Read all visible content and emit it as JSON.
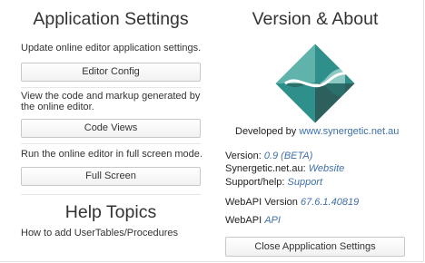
{
  "settings": {
    "title": "Application Settings",
    "items": [
      {
        "description": "Update online editor application settings.",
        "button": "Editor Config"
      },
      {
        "description": "View the code and markup generated by the online editor.",
        "button": "Code Views"
      },
      {
        "description": "Run the online editor in full screen mode.",
        "button": "Full Screen"
      }
    ]
  },
  "help": {
    "title": "Help Topics",
    "topics": [
      "How to add UserTables/Procedures"
    ]
  },
  "about": {
    "title": "Version & About",
    "logo_icon": "synergetic-logo-icon",
    "developed_by_label": "Developed by",
    "developed_by_link": "www.synergetic.net.au",
    "version_label": "Version:",
    "version_value": "0.9 (BETA)",
    "site_label": "Synergetic.net.au:",
    "site_link": "Website",
    "support_label": "Support/help:",
    "support_link": "Support",
    "webapi_version_label": "WebAPI Version",
    "webapi_version_value": "67.6.1.40819",
    "webapi_label": "WebAPI",
    "webapi_link": "API",
    "close_button": "Close Appplication Settings"
  },
  "colors": {
    "logo_teal": "#2f8f8a",
    "logo_dark": "#2d5f5c",
    "logo_light": "#8ec8c2",
    "link": "#3f6fa8"
  }
}
